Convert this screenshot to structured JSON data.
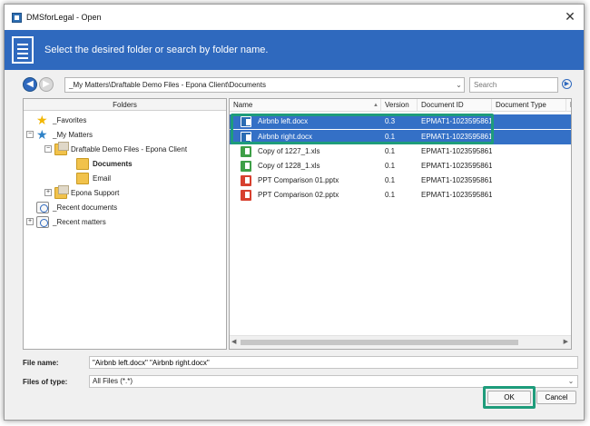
{
  "window": {
    "title": "DMSforLegal - Open",
    "close_glyph": "✕"
  },
  "banner": {
    "text": "Select the desired folder or search by folder name."
  },
  "nav": {
    "back_glyph": "◀",
    "forward_glyph": "▶",
    "path": "_My Matters\\Draftable Demo Files - Epona Client\\Documents",
    "path_dropdown_glyph": "⌄",
    "search_placeholder": "Search",
    "search_go_glyph": "▶"
  },
  "folders": {
    "header": "Folders",
    "items": [
      {
        "label": "_Favorites",
        "expander": ""
      },
      {
        "label": "_My Matters",
        "expander": "−"
      },
      {
        "label": "Draftable Demo Files - Epona Client",
        "expander": "−"
      },
      {
        "label": "Documents",
        "expander": ""
      },
      {
        "label": "Email",
        "expander": ""
      },
      {
        "label": "Epona Support",
        "expander": "+"
      },
      {
        "label": "_Recent documents",
        "expander": ""
      },
      {
        "label": "_Recent matters",
        "expander": "+"
      }
    ]
  },
  "files": {
    "columns": [
      "Name",
      "Version",
      "Document ID",
      "Document Type",
      "D"
    ],
    "sort_glyph": "▲",
    "rows": [
      {
        "name": "Airbnb left.docx",
        "version": "0.3",
        "doc_id": "EPMAT1-1023595861...",
        "type": "docx",
        "selected": true
      },
      {
        "name": "Airbnb right.docx",
        "version": "0.1",
        "doc_id": "EPMAT1-1023595861...",
        "type": "docx",
        "selected": true
      },
      {
        "name": "Copy of 1227_1.xls",
        "version": "0.1",
        "doc_id": "EPMAT1-1023595861...",
        "type": "xls",
        "selected": false
      },
      {
        "name": "Copy of 1228_1.xls",
        "version": "0.1",
        "doc_id": "EPMAT1-1023595861...",
        "type": "xls",
        "selected": false
      },
      {
        "name": "PPT Comparison 01.pptx",
        "version": "0.1",
        "doc_id": "EPMAT1-1023595861...",
        "type": "ppt",
        "selected": false
      },
      {
        "name": "PPT Comparison 02.pptx",
        "version": "0.1",
        "doc_id": "EPMAT1-1023595861...",
        "type": "ppt",
        "selected": false
      }
    ],
    "scroll_left_glyph": "◀",
    "scroll_right_glyph": "▶"
  },
  "footer": {
    "file_name_label": "File name:",
    "file_name_value": "\"Airbnb left.docx\" \"Airbnb right.docx\"",
    "file_type_label": "Files of type:",
    "file_type_value": "All Files (*.*)",
    "file_type_dropdown_glyph": "⌄",
    "ok_label": "OK",
    "cancel_label": "Cancel"
  },
  "colors": {
    "accent": "#2f69be",
    "selection": "#3470c6",
    "highlight": "#1e9c7b"
  }
}
